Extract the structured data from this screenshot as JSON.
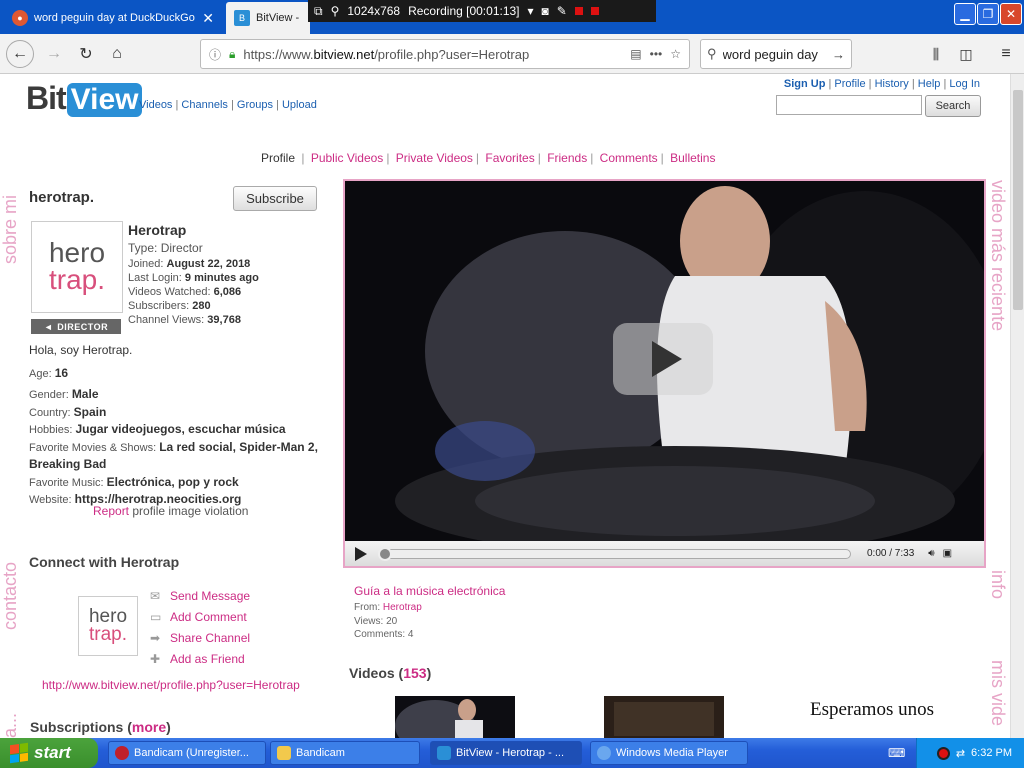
{
  "browser": {
    "tabs": [
      {
        "title": "word peguin day at DuckDuckGo",
        "active": false
      },
      {
        "title": "BitView - H",
        "active": true
      }
    ],
    "url_prefix": "https://www.",
    "url_domain": "bitview.net",
    "url_path": "/profile.php?user=Herotrap",
    "search_query": "word peguin day"
  },
  "recorder": {
    "resolution": "1024x768",
    "status": "Recording [00:01:13]"
  },
  "site": {
    "logo_left": "Bit",
    "logo_right": "View",
    "nav": {
      "videos": "Videos",
      "channels": "Channels",
      "groups": "Groups",
      "upload": "Upload"
    },
    "user_nav": {
      "signup": "Sign Up",
      "profile": "Profile",
      "history": "History",
      "help": "Help",
      "login": "Log In"
    },
    "search_button": "Search"
  },
  "profile_tabs": {
    "current": "Profile",
    "items": [
      "Public Videos",
      "Private Videos",
      "Favorites",
      "Friends",
      "Comments",
      "Bulletins"
    ]
  },
  "side_labels": {
    "left_top": "sobre mi",
    "left_mid": "contacto",
    "left_bottom": "a...",
    "right_top": "video más reciente",
    "right_mid": "info",
    "right_bottom": "mis vide"
  },
  "channel": {
    "name": "herotrap.",
    "subscribe": "Subscribe",
    "avatar_line1": "hero",
    "avatar_line2": "trap.",
    "badge": "DIRECTOR",
    "username": "Herotrap",
    "type_label": "Type:",
    "type_value": "Director",
    "joined_label": "Joined:",
    "joined_value": "August 22, 2018",
    "last_login_label": "Last Login:",
    "last_login_value": "9 minutes ago",
    "watched_label": "Videos Watched:",
    "watched_value": "6,086",
    "subscribers_label": "Subscribers:",
    "subscribers_value": "280",
    "views_label": "Channel Views:",
    "views_value": "39,768"
  },
  "about": {
    "bio": "Hola, soy Herotrap.",
    "age_label": "Age:",
    "age_value": "16",
    "gender_label": "Gender:",
    "gender_value": "Male",
    "country_label": "Country:",
    "country_value": "Spain",
    "hobbies_label": "Hobbies:",
    "hobbies_value": "Jugar videojuegos, escuchar música",
    "movies_label": "Favorite Movies & Shows:",
    "movies_value": "La red social, Spider-Man 2, Breaking Bad",
    "music_label": "Favorite Music:",
    "music_value": "Electrónica, pop y rock",
    "website_label": "Website:",
    "website_value": "https://herotrap.neocities.org",
    "report_link": "Report",
    "report_text": "profile image violation"
  },
  "connect": {
    "title": "Connect with Herotrap",
    "actions": [
      "Send Message",
      "Add Comment",
      "Share Channel",
      "Add as Friend"
    ],
    "profile_url": "http://www.bitview.net/profile.php?user=Herotrap"
  },
  "subscriptions": {
    "title": "Subscriptions (",
    "more": "more",
    "close": ")"
  },
  "video": {
    "time": "0:00 / 7:33",
    "progress": 0,
    "title": "Guía a la música electrónica",
    "from_label": "From:",
    "from_value": "Herotrap",
    "views_label": "Views:",
    "views_value": "20",
    "comments_label": "Comments:",
    "comments_value": "4"
  },
  "videos_section": {
    "title": "Videos (",
    "count": "153",
    "close": ")",
    "placeholder_text": "Esperamos unos"
  },
  "taskbar": {
    "start": "start",
    "tasks": [
      "Bandicam (Unregister...",
      "Bandicam",
      "BitView - Herotrap - ...",
      "Windows Media Player"
    ],
    "clock": "6:32 PM"
  },
  "colors": {
    "accent_pink": "#cc2c84",
    "link_blue": "#1b5fb0",
    "xp_blue": "#245ed8"
  }
}
